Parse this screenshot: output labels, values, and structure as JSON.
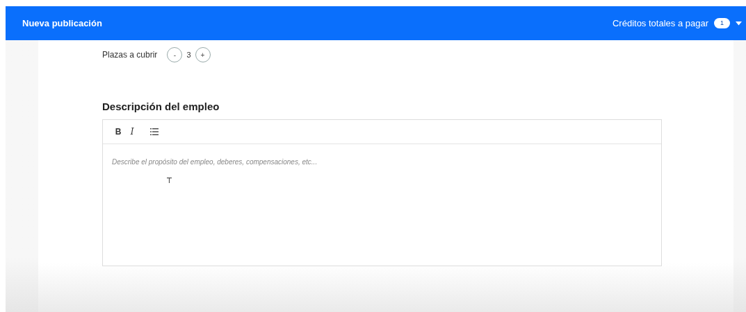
{
  "header": {
    "title": "Nueva publicación",
    "credits_label": "Créditos totales a pagar",
    "credits_count": "1"
  },
  "vacancies": {
    "label": "Plazas a cubrir",
    "decrement": "-",
    "value": "3",
    "increment": "+"
  },
  "description": {
    "heading": "Descripción del empleo",
    "toolbar": [
      {
        "kind": "bold",
        "label": "B"
      },
      {
        "kind": "italic",
        "label": "I"
      },
      {
        "kind": "list"
      }
    ],
    "placeholder": "Describe el propósito del empleo, deberes, compensaciones, etc..."
  }
}
